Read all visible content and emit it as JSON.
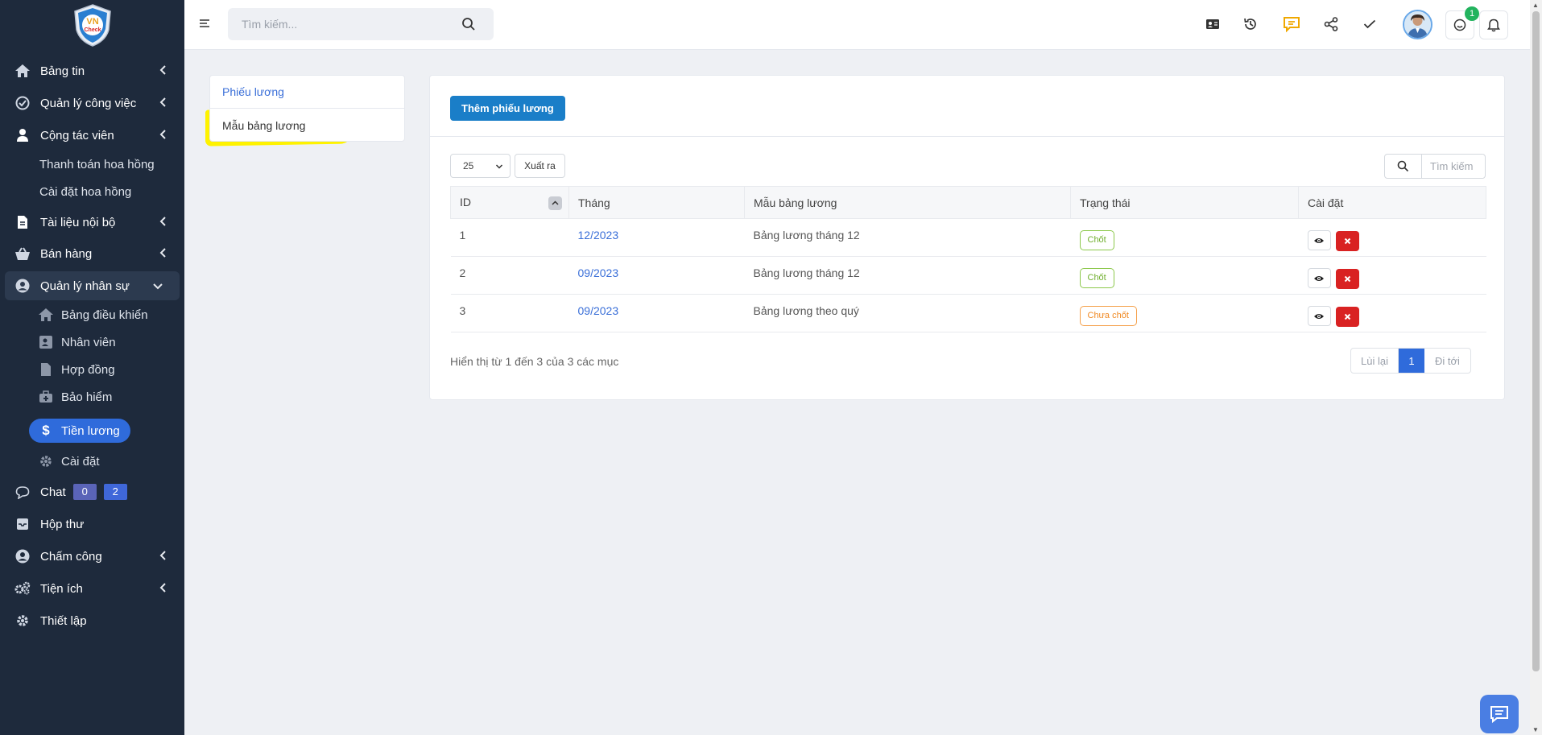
{
  "app": {
    "logo_text": "VN Check"
  },
  "sidebar": {
    "items": [
      {
        "label": "Bảng tin",
        "icon": "home-icon"
      },
      {
        "label": "Quản lý công việc",
        "icon": "check-circle-icon"
      },
      {
        "label": "Cộng tác viên",
        "icon": "user-icon"
      },
      {
        "label": "Tài liệu nội bộ",
        "icon": "document-icon"
      },
      {
        "label": "Bán hàng",
        "icon": "basket-icon"
      },
      {
        "label": "Quản lý nhân sự",
        "icon": "user-circle-icon"
      },
      {
        "label": "Chat",
        "icon": "chat-bubble-icon"
      },
      {
        "label": "Hộp thư",
        "icon": "inbox-icon"
      },
      {
        "label": "Chấm công",
        "icon": "user-circle-icon"
      },
      {
        "label": "Tiện ích",
        "icon": "gears-icon"
      },
      {
        "label": "Thiết lập",
        "icon": "gear-icon"
      }
    ],
    "ctv_sub": [
      "Thanh toán hoa hồng",
      "Cài đặt hoa hồng"
    ],
    "hr_sub": [
      {
        "label": "Bảng điều khiển",
        "icon": "home-icon"
      },
      {
        "label": "Nhân viên",
        "icon": "id-card-icon"
      },
      {
        "label": "Hợp đồng",
        "icon": "file-icon"
      },
      {
        "label": "Bảo hiểm",
        "icon": "medical-kit-icon"
      },
      {
        "label": "Tiền lương",
        "icon": "dollar-icon"
      },
      {
        "label": "Cài đặt",
        "icon": "gear-icon"
      }
    ],
    "chat_badges": [
      "0",
      "2"
    ],
    "chat_badge_colors": [
      "#5a64b8",
      "#3f67d9"
    ]
  },
  "topbar": {
    "search_placeholder": "Tìm kiếm...",
    "notification_count": "1",
    "icons": [
      "contact-card-icon",
      "history-icon",
      "comment-icon",
      "share-icon",
      "check-icon",
      "avatar",
      "smile-icon",
      "bell-icon"
    ]
  },
  "tabs": {
    "items": [
      "Phiếu lương",
      "Mẫu bảng lương"
    ]
  },
  "main": {
    "add_button": "Thêm phiếu lương",
    "page_size": "25",
    "export_button": "Xuất ra",
    "search_placeholder": "Tìm kiếm",
    "table": {
      "columns": [
        "ID",
        "Tháng",
        "Mẫu bảng lương",
        "Trạng thái",
        "Cài đặt"
      ],
      "rows": [
        {
          "id": "1",
          "month": "12/2023",
          "template": "Bảng lương tháng 12",
          "status": "Chốt",
          "status_color": "green"
        },
        {
          "id": "2",
          "month": "09/2023",
          "template": "Bảng lương tháng 12",
          "status": "Chốt",
          "status_color": "green"
        },
        {
          "id": "3",
          "month": "09/2023",
          "template": "Bảng lương theo quý",
          "status": "Chưa chốt",
          "status_color": "orange"
        }
      ]
    },
    "info": "Hiển thị từ 1 đến 3 của 3 các mục",
    "pager": {
      "prev": "Lùi lại",
      "current": "1",
      "next": "Đi tới"
    }
  },
  "colors": {
    "sidebar_bg": "#1e2a3c",
    "accent": "#2f6bdb",
    "primary_button": "#1a7ec8",
    "danger": "#d92222",
    "highlight": "#fef200"
  }
}
